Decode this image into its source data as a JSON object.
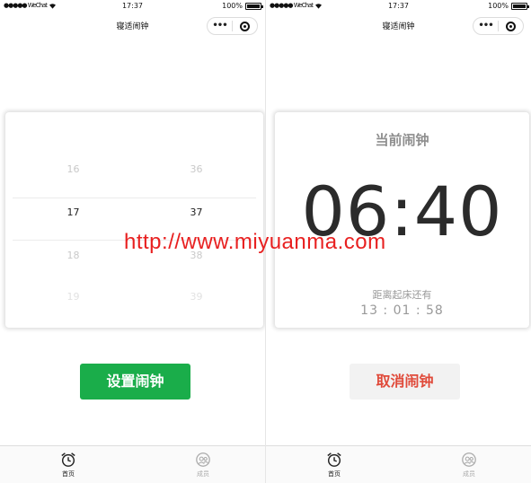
{
  "status_bar": {
    "carrier": "●●●●● WeChat",
    "time": "17:37",
    "battery": "100%"
  },
  "nav": {
    "title": "寝适闹钟"
  },
  "picker": {
    "hours": [
      "16",
      "17",
      "18",
      "19"
    ],
    "minutes": [
      "36",
      "37",
      "38",
      "39"
    ]
  },
  "alarm": {
    "title": "当前闹钟",
    "time": "06:40",
    "subtitle": "距离起床还有",
    "countdown": "13 : 01 : 58"
  },
  "buttons": {
    "set": "设置闹钟",
    "cancel": "取消闹钟"
  },
  "watermark": "http://www.miyuanma.com",
  "tabs": [
    {
      "label": "首页",
      "icon": "alarm-clock-icon",
      "active": true
    },
    {
      "label": "成员",
      "icon": "member-icon",
      "active": false
    }
  ],
  "colors": {
    "primary_green": "#1aad4a",
    "cancel_red": "#e04a3a",
    "watermark_red": "#e82020",
    "muted_gray": "#999999"
  }
}
